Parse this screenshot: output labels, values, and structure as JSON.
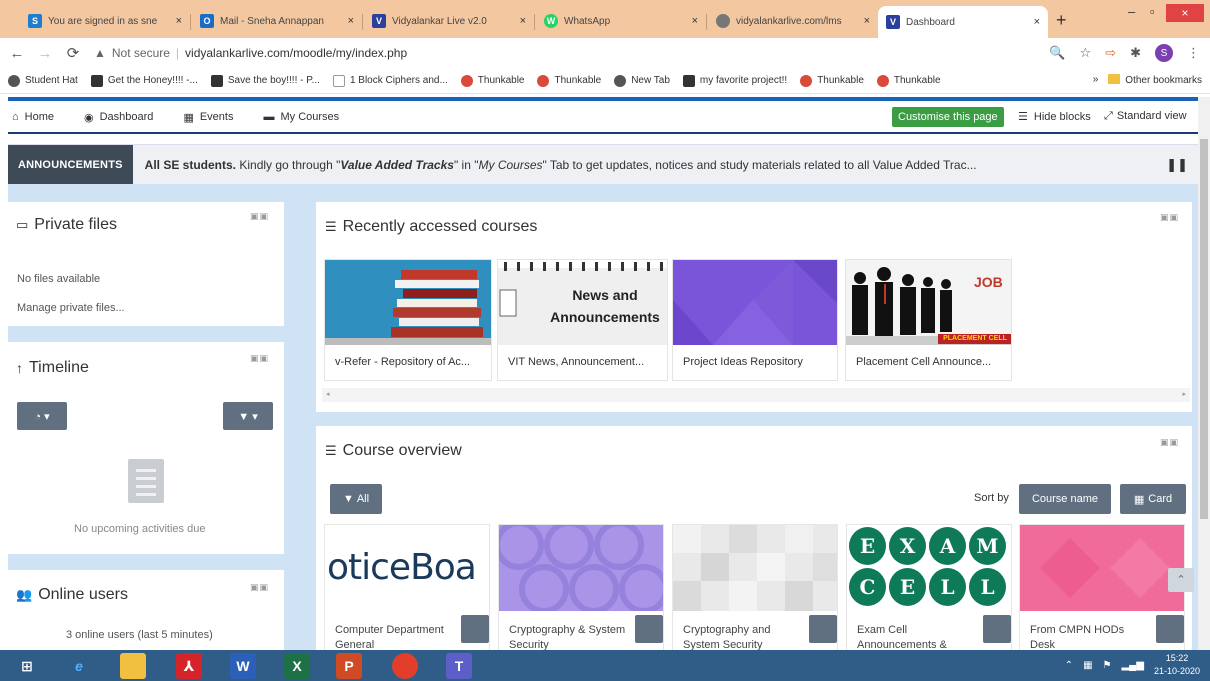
{
  "browser": {
    "tabs": [
      {
        "label": "You are signed in as sne",
        "favicon": "S",
        "color": "#1f7dd0"
      },
      {
        "label": "Mail - Sneha Annappan",
        "favicon": "O",
        "color": "#1a6cc9"
      },
      {
        "label": "Vidyalankar Live v2.0",
        "favicon": "V",
        "color": "#2b3f9e"
      },
      {
        "label": "WhatsApp",
        "favicon": "W",
        "color": "#25d366"
      },
      {
        "label": "vidyalankarlive.com/lms",
        "favicon": "",
        "color": "#777777"
      },
      {
        "label": "Dashboard",
        "favicon": "V",
        "color": "#2b3f9e"
      }
    ],
    "close_glyph": "×",
    "new_tab_glyph": "+",
    "security_label": "Not secure",
    "url": "vidyalankarlive.com/moodle/my/index.php",
    "profile_initial": "S",
    "bookmarks": [
      "Student Hat",
      "Get the Honey!!!! -...",
      "Save the boy!!!! - P...",
      "1 Block Ciphers and...",
      "Thunkable",
      "Thunkable",
      "New Tab",
      "my favorite project!!",
      "Thunkable",
      "Thunkable"
    ],
    "bookmarks_overflow": "»",
    "other_bookmarks": "Other bookmarks"
  },
  "moodle_nav": {
    "items": [
      "Home",
      "Dashboard",
      "Events",
      "My Courses"
    ],
    "customise_label": "Customise this page",
    "hide_blocks_label": "Hide blocks",
    "standard_view_label": "Standard view"
  },
  "announcements": {
    "label": "ANNOUNCEMENTS",
    "text_bold": "All SE students.",
    "text_1": " Kindly go through \"",
    "text_em1": "Value Added Tracks",
    "text_2": "\" in \"",
    "text_em2": "My Courses",
    "text_3": "\" Tab to get updates, notices and study materials related to all  Value Added Trac...",
    "pause_glyph": "❚❚"
  },
  "private_files": {
    "title": "Private files",
    "empty": "No files available",
    "manage": "Manage private files..."
  },
  "timeline": {
    "title": "Timeline",
    "empty": "No upcoming activities due"
  },
  "online_users": {
    "title": "Online users",
    "summary": "3 online users (last 5 minutes)"
  },
  "recent_courses": {
    "title": "Recently accessed courses",
    "items": [
      {
        "name": "v-Refer - Repository of Ac..."
      },
      {
        "name": "VIT News, Announcement..."
      },
      {
        "name": "Project Ideas Repository"
      },
      {
        "name": "Placement Cell Announce..."
      }
    ],
    "news_title": "News and Announcements",
    "job_badge": "JOB",
    "placement_badge": "PLACEMENT CELL"
  },
  "course_overview": {
    "title": "Course overview",
    "filter_all": "All",
    "sort_by_label": "Sort by",
    "sort_course_name": "Course name",
    "view_card": "Card",
    "notice_logo_text": "oticeBoa",
    "exam_cell_letters": [
      "E",
      "X",
      "A",
      "M",
      "C",
      "E",
      "L",
      "L"
    ],
    "items": [
      {
        "name": "Computer Department General"
      },
      {
        "name": "Cryptography & System Security"
      },
      {
        "name": "Cryptography and System Security"
      },
      {
        "name": "Exam Cell Announcements &"
      },
      {
        "name": "From CMPN HODs Desk"
      }
    ]
  },
  "taskbar": {
    "time": "15:22",
    "date": "21-10-2020"
  }
}
